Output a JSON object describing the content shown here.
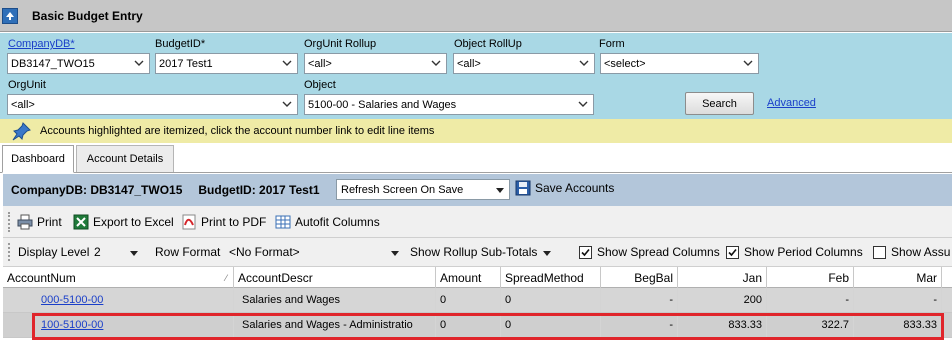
{
  "window": {
    "title": "Basic Budget Entry"
  },
  "filters": {
    "company_db": {
      "label": "CompanyDB*",
      "value": "DB3147_TWO15"
    },
    "budget_id": {
      "label": "BudgetID*",
      "value": "2017 Test1"
    },
    "orgunit_rollup": {
      "label": "OrgUnit Rollup",
      "value": "<all>"
    },
    "object_rollup": {
      "label": "Object RollUp",
      "value": "<all>"
    },
    "form": {
      "label": "Form",
      "value": "<select>"
    },
    "orgunit": {
      "label": "OrgUnit",
      "value": "<all>"
    },
    "object": {
      "label": "Object",
      "value": "5100-00 - Salaries and Wages"
    },
    "search_label": "Search",
    "advanced_label": "Advanced"
  },
  "notice": {
    "text": "Accounts highlighted are itemized, click the account number link to edit line items"
  },
  "tabs": [
    {
      "label": "Dashboard"
    },
    {
      "label": "Account Details"
    }
  ],
  "infobar": {
    "company": "CompanyDB: DB3147_TWO15",
    "budget": "BudgetID: 2017 Test1",
    "refresh_mode": "Refresh Screen On Save",
    "save_label": "Save Accounts"
  },
  "toolbar": {
    "print": "Print",
    "export_excel": "Export to Excel",
    "print_pdf": "Print to PDF",
    "autofit": "Autofit Columns"
  },
  "options": {
    "display_level_label": "Display Level",
    "display_level_value": "2",
    "row_format_label": "Row Format",
    "row_format_value": "<No Format>",
    "rollup_label": "Show Rollup Sub-Totals",
    "spread_label": "Show Spread Columns",
    "period_label": "Show Period Columns",
    "assumptions_label": "Show Assu"
  },
  "grid": {
    "columns": [
      "AccountNum",
      "AccountDescr",
      "Amount",
      "SpreadMethod",
      "BegBal",
      "Jan",
      "Feb",
      "Mar"
    ],
    "rows": [
      {
        "account": "000-5100-00",
        "descr": "Salaries and Wages",
        "amount": "0",
        "spread": "0",
        "begbal": "-",
        "jan": "200",
        "feb": "-",
        "mar": "-"
      },
      {
        "account": "100-5100-00",
        "descr": "Salaries and Wages - Administratio",
        "amount": "0",
        "spread": "0",
        "begbal": "-",
        "jan": "833.33",
        "feb": "322.7",
        "mar": "833.33"
      }
    ]
  },
  "colors": {
    "filter_bg": "#a9d8e5",
    "notice_bg": "#efeba6",
    "info_bg": "#b3c6da",
    "highlight": "#e0252b"
  }
}
